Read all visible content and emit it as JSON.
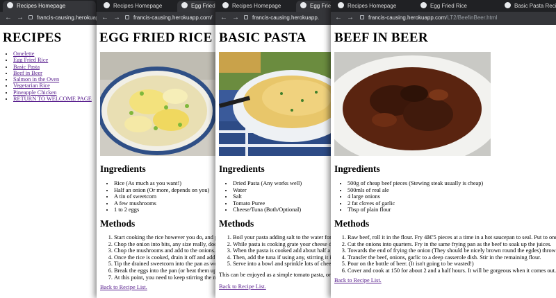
{
  "win1": {
    "tab_title": "Recipes Homepage",
    "url_host": "francis-causing.herokuapp.com",
    "heading": "RECIPES",
    "links": [
      "Omelette",
      "Egg Fried Rice",
      "Basic Pasta",
      "Beef in Beer",
      "Salmon in the Oven",
      "Vegetarian Rice",
      "Pineapple Chicken",
      "RETURN TO WELCOME PAGE"
    ]
  },
  "win2": {
    "tabs": [
      "Recipes Homepage",
      "Egg Fried R"
    ],
    "url_host": "francis-causing.herokuapp.com/",
    "heading": "EGG FRIED RICE",
    "ingredients_heading": "Ingredients",
    "ingredients": [
      "Rice (As much as you want!)",
      "Half an onion (Or more, depends on you)",
      "A tin of sweetcorn",
      "A few mushrooms",
      "1 to 2 eggs"
    ],
    "methods_heading": "Methods",
    "methods": [
      "Start cooking the rice however you do, and put",
      "Chop the onion into bits, any size really, doesn",
      "Chop the mushrooms and add to the onions.",
      "Once the rice is cooked, drain it off and add it",
      "Tip the drained sweetcorn into the pan as well",
      "Break the eggs into the pan (or beat them up b",
      "At this point, you need to keep stirring the mi"
    ],
    "back_link": "Back to Recipe List."
  },
  "win3": {
    "tabs": [
      "Recipes Homepage",
      "Egg Fried"
    ],
    "url_host": "francis-causing.herokuapp.",
    "heading": "BASIC PASTA",
    "ingredients_heading": "Ingredients",
    "ingredients": [
      "Dried Pasta (Any works well)",
      "Water",
      "Salt",
      "Tomato Puree",
      "Cheese/Tuna (Both/Optional)"
    ],
    "methods_heading": "Methods",
    "methods": [
      "Boil your pasta adding salt to the water for f",
      "While pasta is cooking grate your cheese dra",
      "When the pasta is cooked add about half a t",
      "Then, add the tuna if using any, stirring it in",
      "Serve into a bowl and sprinkle lots of cheese"
    ],
    "note": "This can be enjoyed as a simple tomato pasta, or w",
    "back_link": "Back to Recipe List."
  },
  "win4": {
    "tabs": [
      "Recipes Homepage",
      "Egg Fried Rice",
      "Basic Pasta Recipe"
    ],
    "url_host": "francis-causing.herokuapp.com",
    "url_path": "/LT2/BeefinBeer.html",
    "heading": "BEEF IN BEER",
    "ingredients_heading": "Ingredients",
    "ingredients": [
      "500g of cheap beef pieces (Stewing steak usually is cheap)",
      "500mls of real ale",
      "4 large onions",
      "2 fat cloves of garlic",
      "Tbsp of plain flour"
    ],
    "methods_heading": "Methods",
    "methods": [
      "Raw beef, roll it in the flour. Fry 4â€'5 pieces at a time in a hot saucepan to seal. Put to one s",
      "Cut the onions into quarters. Fry in the same frying pan as the beef to soak up the juices.",
      "Towards the end of frying the onion (They should be nicely brown round the egdes) throw in t",
      "Transfer the beef, onions, garlic to a deep casserole dish. Stir in the remaining flour.",
      "Pour on the bottle of beer. (It isn't going to be wasted!)",
      "Cover and cook at 150 for about 2 and a half hours. It will be gorgeous when it comes out. Se"
    ],
    "back_link": "Back to Recipe List."
  },
  "nav_icons": [
    "back-arrow-icon",
    "forward-arrow-icon",
    "lock-icon"
  ],
  "colors": {
    "chrome_dark": "#202124",
    "chrome_tab": "#35363a",
    "link_visited": "#551a8b"
  }
}
